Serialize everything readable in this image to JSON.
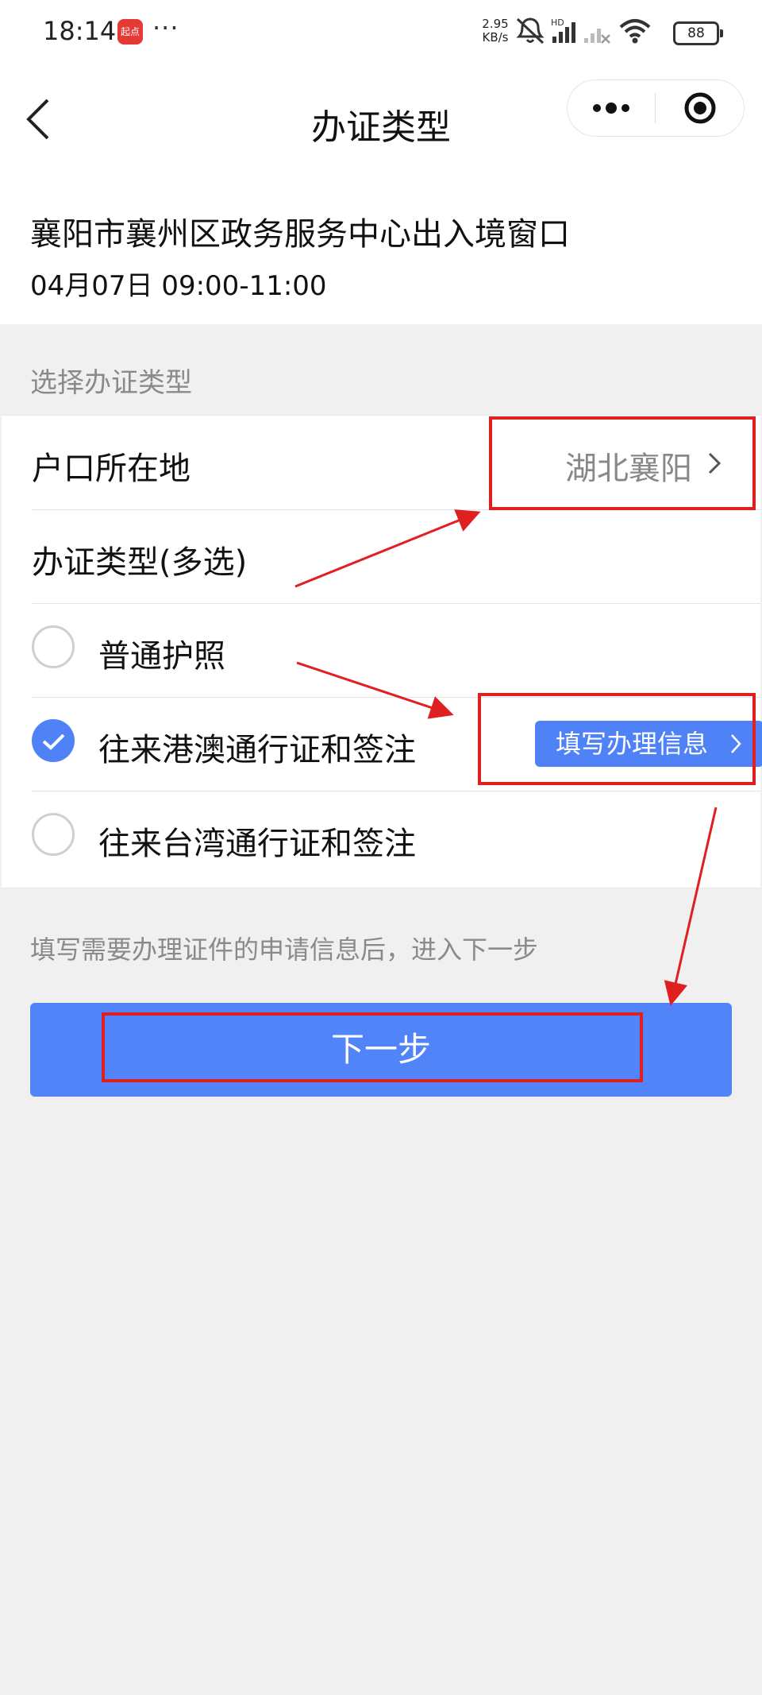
{
  "status_bar": {
    "time": "18:14",
    "app_badge": "起点",
    "more": "···",
    "net_speed_value": "2.95",
    "net_speed_unit": "KB/s",
    "hd": "HD",
    "battery": "88"
  },
  "nav": {
    "title": "办证类型"
  },
  "info": {
    "name": "襄阳市襄州区政务服务中心出入境窗口",
    "time": "04月07日 09:00-11:00"
  },
  "section": {
    "label": "选择办证类型"
  },
  "form": {
    "residence_label": "户口所在地",
    "residence_value": "湖北襄阳",
    "type_label": "办证类型(多选)",
    "options": [
      {
        "label": "普通护照",
        "checked": false
      },
      {
        "label": "往来港澳通行证和签注",
        "checked": true
      },
      {
        "label": "往来台湾通行证和签注",
        "checked": false
      }
    ],
    "fill_info_label": "填写办理信息"
  },
  "hint": "填写需要办理证件的申请信息后，进入下一步",
  "next_label": "下一步",
  "colors": {
    "accent": "#4f82f7",
    "annotation": "#e02020"
  }
}
